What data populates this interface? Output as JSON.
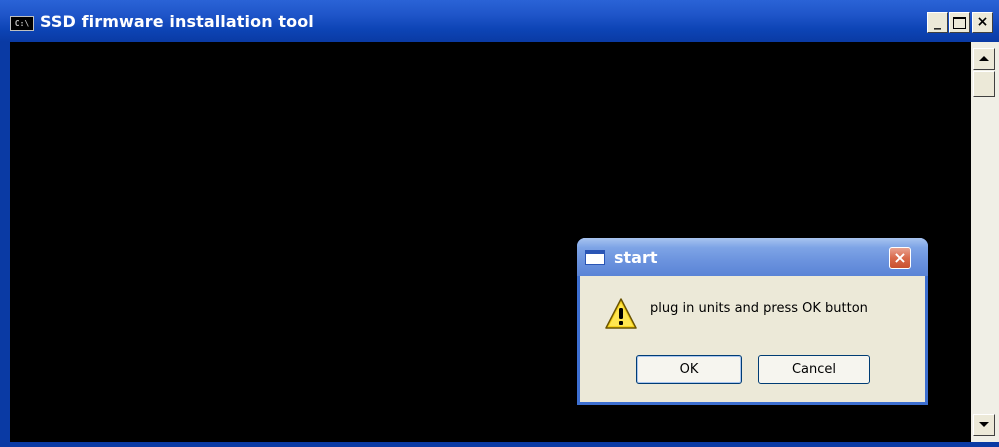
{
  "window": {
    "title": "SSD firmware installation tool",
    "icon_text": "C:\\",
    "controls": {
      "minimize_icon": "minimize-icon",
      "maximize_icon": "maximize-icon",
      "close_icon": "close-icon",
      "minimize_label": "_",
      "close_label": "×"
    }
  },
  "dialog": {
    "title": "start",
    "message": "plug in units and press OK button",
    "close_label": "×",
    "buttons": {
      "ok": "OK",
      "cancel": "Cancel"
    },
    "icon": "warning-icon"
  },
  "colors": {
    "titlebar": "#1f55c9",
    "console_bg": "#000000",
    "dialog_bg": "#ece9d8"
  }
}
